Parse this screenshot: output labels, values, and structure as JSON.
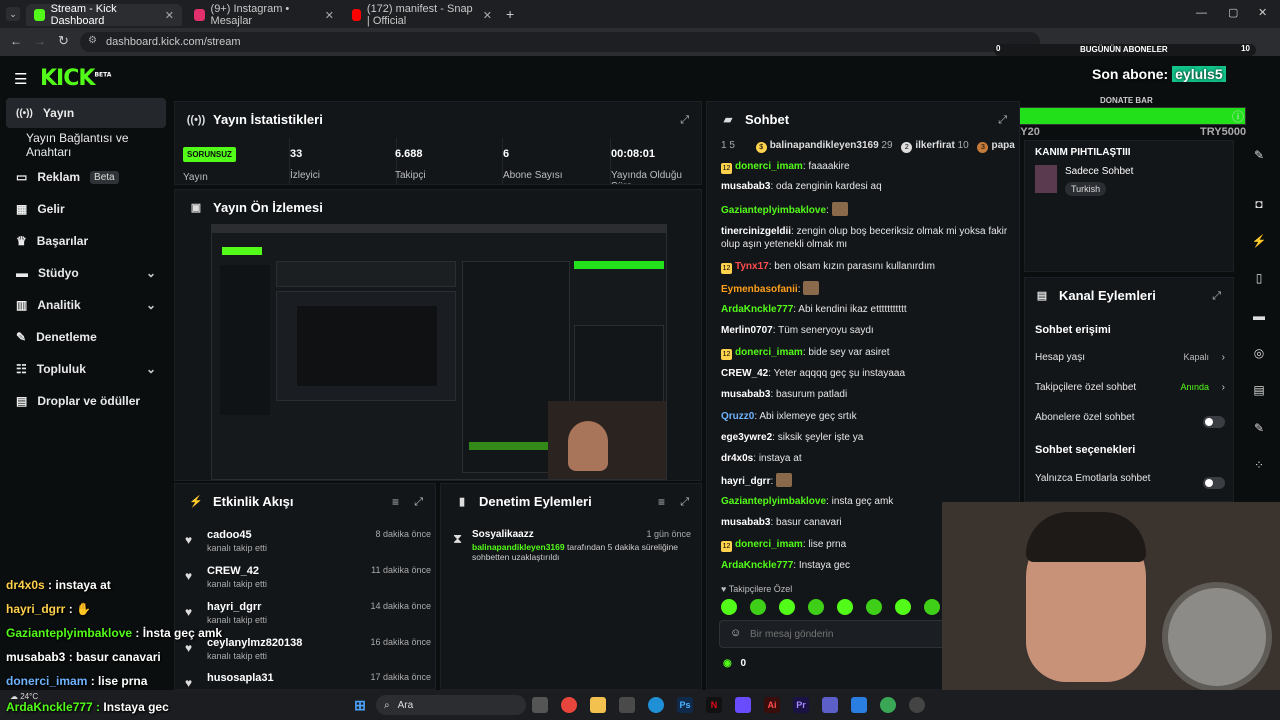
{
  "browser": {
    "tabs": [
      {
        "title": "Stream - Kick Dashboard",
        "color": "#53fc18"
      },
      {
        "title": "(9+) Instagram • Mesajlar",
        "color": "#e1306c"
      },
      {
        "title": "(172) manifest - Snap | Official",
        "color": "#ff0000"
      }
    ],
    "url": "dashboard.kick.com/stream"
  },
  "overlay_top": {
    "bugunun_aboneler": "BUGÜNÜN ABONELER",
    "left_count": "0",
    "right_count": "10",
    "son_abone_label": "Son abone:",
    "son_abone_name": "eyluls5",
    "donate_bar": "DONATE BAR",
    "try_left": "TRY20",
    "try_right": "TRY5000"
  },
  "kick": {
    "logo": "KICK",
    "beta": "BETA"
  },
  "sidebar": {
    "items": [
      {
        "label": "Yayın",
        "icon": "broadcast-icon"
      },
      {
        "label": "Yayın Bağlantısı ve Anahtarı",
        "icon": ""
      },
      {
        "label": "Reklam",
        "icon": "ad-icon",
        "badge": "Beta"
      },
      {
        "label": "Gelir",
        "icon": "chart-icon"
      },
      {
        "label": "Başarılar",
        "icon": "trophy-icon"
      },
      {
        "label": "Stüdyo",
        "icon": "studio-icon"
      },
      {
        "label": "Analitik",
        "icon": "analytics-icon"
      },
      {
        "label": "Denetleme",
        "icon": "wrench-icon"
      },
      {
        "label": "Topluluk",
        "icon": "community-icon"
      },
      {
        "label": "Droplar ve ödüller",
        "icon": "drops-icon"
      }
    ]
  },
  "stats": {
    "title": "Yayın İstatistikleri",
    "badge": "SORUNSUZ",
    "yayin_label": "Yayın",
    "items": [
      {
        "value": "33",
        "label": "İzleyici"
      },
      {
        "value": "6.688",
        "label": "Takipçi"
      },
      {
        "value": "6",
        "label": "Abone Sayısı"
      },
      {
        "value": "00:08:01",
        "label": "Yayında Olduğu Süre"
      }
    ]
  },
  "preview": {
    "title": "Yayın Ön İzlemesi"
  },
  "activity": {
    "title": "Etkinlik Akışı",
    "items": [
      {
        "name": "cadoo45",
        "sub": "kanalı takip etti",
        "time": "8 dakika önce"
      },
      {
        "name": "CREW_42",
        "sub": "kanalı takip etti",
        "time": "11 dakika önce"
      },
      {
        "name": "hayri_dgrr",
        "sub": "kanalı takip etti",
        "time": "14 dakika önce"
      },
      {
        "name": "ceylanylmz820138",
        "sub": "kanalı takip etti",
        "time": "16 dakika önce"
      },
      {
        "name": "husosapla31",
        "sub": "",
        "time": "17 dakika önce"
      }
    ]
  },
  "moderation": {
    "title": "Denetim Eylemleri",
    "item_name": "Sosyalikaazz",
    "item_time": "1 gün önce",
    "item_actor": "balinapandikleyen3169",
    "item_text": "tarafından 5 dakika süreliğine sohbetten uzaklaştırıldı"
  },
  "chat": {
    "title": "Sohbet",
    "top_row": [
      {
        "name": "balinapandikleyen3169",
        "count": "29"
      },
      {
        "name": "ilkerfirat",
        "count": "10"
      },
      {
        "name": "papa",
        "count": ""
      }
    ],
    "messages": [
      {
        "user": "donerci_imam",
        "color": "#53fc18",
        "badge": true,
        "text": "faaaakire"
      },
      {
        "user": "musabab3",
        "color": "#ffffff",
        "badge": false,
        "text": "oda zenginin kardesi aq"
      },
      {
        "user": "Gazianteplyimbaklove",
        "color": "#53fc18",
        "badge": false,
        "text": ""
      },
      {
        "user": "tinercinizgeldii",
        "color": "#ffffff",
        "badge": false,
        "text": "zengin olup boş beceriksiz olmak mi yoksa fakir olup aşın yetenekli olmak mı"
      },
      {
        "user": "Tynx17",
        "color": "#ff4d4d",
        "badge": true,
        "text": "ben olsam kızın parasını kullanırdım"
      },
      {
        "user": "Eymenbasofanii",
        "color": "#ff9f1c",
        "badge": false,
        "text": ""
      },
      {
        "user": "ArdaKnckle777",
        "color": "#53fc18",
        "badge": false,
        "text": "Abi kendini ikaz ettttttttttt"
      },
      {
        "user": "Merlin0707",
        "color": "#ffffff",
        "badge": false,
        "text": "Tüm seneryoyu saydı"
      },
      {
        "user": "donerci_imam",
        "color": "#53fc18",
        "badge": true,
        "text": "bide sey var asiret"
      },
      {
        "user": "CREW_42",
        "color": "#ffffff",
        "badge": false,
        "text": "Yeter aqqqq geç şu instayaaa"
      },
      {
        "user": "musabab3",
        "color": "#ffffff",
        "badge": false,
        "text": "basurum patladi"
      },
      {
        "user": "Qruzz0",
        "color": "#6fb3ff",
        "badge": false,
        "text": "Abi ixlemeye geç srtık"
      },
      {
        "user": "ege3ywre2",
        "color": "#ffffff",
        "badge": false,
        "text": "siksik şeyler işte ya"
      },
      {
        "user": "dr4x0s",
        "color": "#ffffff",
        "badge": false,
        "text": "instaya at"
      },
      {
        "user": "hayri_dgrr",
        "color": "#ffffff",
        "badge": false,
        "text": ""
      },
      {
        "user": "Gazianteplyimbaklove",
        "color": "#53fc18",
        "badge": false,
        "text": "insta geç amk"
      },
      {
        "user": "musabab3",
        "color": "#ffffff",
        "badge": false,
        "text": "basur canavari"
      },
      {
        "user": "donerci_imam",
        "color": "#53fc18",
        "badge": true,
        "text": "lise prna"
      },
      {
        "user": "ArdaKnckle777",
        "color": "#53fc18",
        "badge": false,
        "text": "Instaya gec"
      }
    ],
    "follower_only": "Takipçilere Özel",
    "input_placeholder": "Bir mesaj gönderin",
    "points": "0"
  },
  "channel_card": {
    "title": "KANIM PIHTILAŞTIII",
    "mode": "Sadece Sohbet",
    "language": "Turkish"
  },
  "channel_actions": {
    "title": "Kanal Eylemleri",
    "section1": "Sohbet erişimi",
    "hesap_yasi": "Hesap yaşı",
    "hesap_yasi_val": "Kapalı",
    "takipci_sohbet": "Takipçilere özel sohbet",
    "takipci_sohbet_val": "Anında",
    "abone_sohbet": "Abonelere özel sohbet",
    "section2": "Sohbet seçenekleri",
    "emote_sohbet": "Yalnızca Emotlarla sohbet"
  },
  "overlay_chat": [
    {
      "user": "dr4x0s",
      "color": "#ffd24d",
      "text": "instaya at"
    },
    {
      "user": "hayri_dgrr",
      "color": "#ffd24d",
      "text": ""
    },
    {
      "user": "Gazianteplyimbaklove",
      "color": "#53fc18",
      "text": "İnsta geç amk"
    },
    {
      "user": "musabab3",
      "color": "#ffffff",
      "text": "basur canavari"
    },
    {
      "user": "donerci_imam",
      "color": "#6fb3ff",
      "text": "lise prna"
    },
    {
      "user": "ArdaKnckle777",
      "color": "#53fc18",
      "text": "Instaya gec"
    }
  ],
  "taskbar": {
    "search": "Ara",
    "weather": "24°C"
  }
}
